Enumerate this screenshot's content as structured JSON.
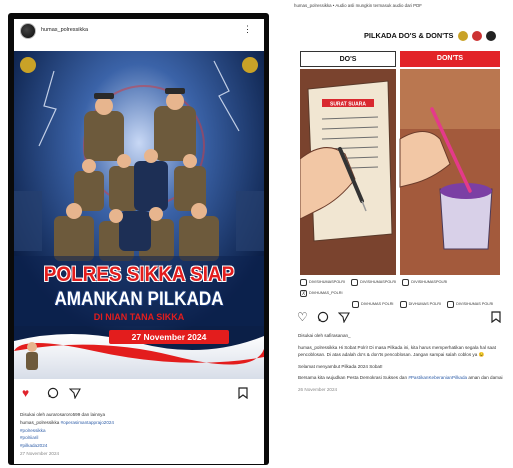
{
  "left_post": {
    "username": "humas_polressikka",
    "more_icon": "more-vertical-icon",
    "poster": {
      "title_line1": "POLRES SIKKA SIAP",
      "title_line2": "AMANKAN PILKADA",
      "subtitle": "DI NIAN TANA SIKKA",
      "date": "27 November 2024"
    },
    "actions": {
      "like_icon": "heart-filled-icon",
      "comment_icon": "comment-icon",
      "share_icon": "send-icon",
      "save_icon": "bookmark-icon",
      "liked_color": "#e0242d"
    },
    "liked_by": "Disukai oleh aurarosaroro599 dan lainnya",
    "caption_user": "humas_polressikka",
    "caption_tag": "#operasimantapprajo2024",
    "hashtags": [
      "#polressikka",
      "#polriiaril",
      "#pilkada2024"
    ],
    "date": "27 November 2024"
  },
  "right_post": {
    "top_text": "humas_polressikka • Audio asli mungkin termasuk audio dari PDF",
    "title": "PILKADA DO'S & DON'TS",
    "col_do": "DO'S",
    "col_dont": "DON'TS",
    "ballot_label": "SURAT SUARA",
    "social_handles": [
      {
        "icon": "instagram-icon",
        "label": "DIVISIHUMASPOLRI"
      },
      {
        "icon": "tiktok-icon",
        "label": "DIVISIHUMASPOLRI"
      },
      {
        "icon": "facebook-icon",
        "label": "DIVISIHUMASPOLRI"
      },
      {
        "icon": "x-icon",
        "label": "DIVHUMAS_POLRI"
      },
      {
        "icon": "instagram-icon",
        "label": "DIVHUMAS POLRI"
      },
      {
        "icon": "youtube-icon",
        "label": "DIVHUMAS POLRI"
      },
      {
        "icon": "globe-icon",
        "label": "DIVISIHUMAS POLRI"
      }
    ],
    "liked_by": "Disukai oleh safirasanan_",
    "caption_user": "humas_polressikka",
    "caption_1": "Hi Sobat Polri! Di masa Pilkada ini, kita harus memperhatikan segala hal saat pencoblosan. Di atas adalah do's & don'ts pencoblosan. Jangan sampai salah coblos ya 😉",
    "caption_2": "Selamat menyambut Pilkada 2024 Sobat!",
    "caption_3_prefix": "Bersama kita wujudkan Pesta Demokrasi Sukses dan ",
    "caption_3_tag": "#PastikanKeberanianPilkada",
    "caption_3_suffix": " aman dan damai",
    "date": "26 November 2024"
  },
  "colors": {
    "poster_red": "#e31d1d",
    "poster_navy": "#0d2a5c",
    "donts_red": "#e22328",
    "hashtag_blue": "#2f5ea8"
  }
}
